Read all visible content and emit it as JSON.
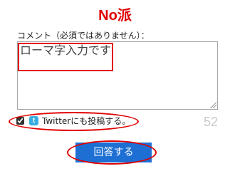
{
  "vote": {
    "title": "No派"
  },
  "comment": {
    "label": "コメント（必須ではありません）：",
    "value": "ローマ字入力です"
  },
  "share": {
    "icon": "twitter-bird-icon",
    "label": "Twitterにも投稿する。",
    "checked": true,
    "remaining_count": "52"
  },
  "submit": {
    "label": "回答する"
  },
  "colors": {
    "title": "#e00000",
    "button": "#1d6fd4",
    "annotation": "#e10000",
    "counter": "#c9c9c9"
  }
}
